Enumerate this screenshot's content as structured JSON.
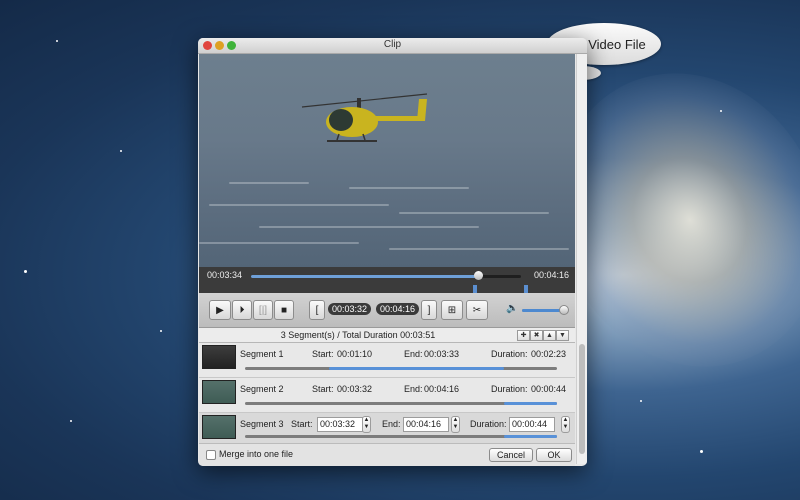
{
  "bubble": {
    "text": "Clip Video File"
  },
  "window": {
    "title": "Clip"
  },
  "player": {
    "current_time": "00:03:34",
    "total_time": "00:04:16",
    "progress_fraction": 0.84
  },
  "controls": {
    "start_time": "00:03:32",
    "end_time": "00:04:16",
    "volume_fraction": 0.9
  },
  "segments_header": "3 Segment(s) / Total Duration 00:03:51",
  "segment_labels": {
    "start": "Start:",
    "end": "End:",
    "duration": "Duration:"
  },
  "segments": [
    {
      "name": "Segment 1",
      "start": "00:01:10",
      "end": "00:03:33",
      "duration": "00:02:23",
      "fill_from": 0.27,
      "fill_to": 0.83
    },
    {
      "name": "Segment 2",
      "start": "00:03:32",
      "end": "00:04:16",
      "duration": "00:00:44",
      "fill_from": 0.83,
      "fill_to": 1.0
    },
    {
      "name": "Segment 3",
      "start": "00:03:32",
      "end": "00:04:16",
      "duration": "00:00:44",
      "fill_from": 0.83,
      "fill_to": 1.0
    }
  ],
  "footer": {
    "merge_label": "Merge into one file",
    "cancel_label": "Cancel",
    "ok_label": "OK"
  },
  "colors": {
    "accent": "#5891d8",
    "close": "#e0443e",
    "minimize": "#dea123",
    "zoom": "#3fb33a"
  }
}
